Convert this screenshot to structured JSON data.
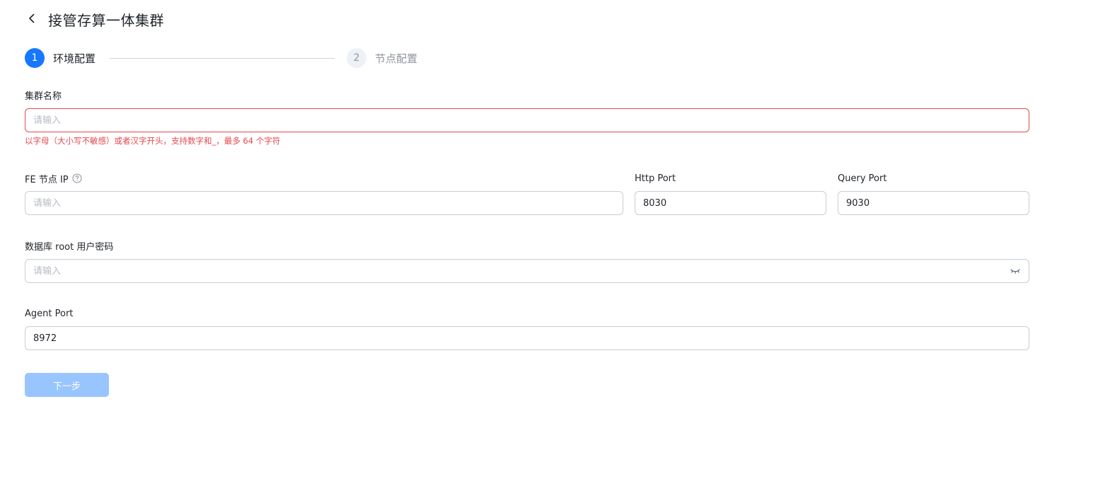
{
  "header": {
    "title": "接管存算一体集群"
  },
  "steps": [
    {
      "number": "1",
      "label": "环境配置",
      "status": "active"
    },
    {
      "number": "2",
      "label": "节点配置",
      "status": "wait"
    }
  ],
  "form": {
    "cluster_name": {
      "label": "集群名称",
      "placeholder": "请输入",
      "value": "",
      "error": "以字母（大小写不敏感）或者汉字开头，支持数字和_，最多 64 个字符"
    },
    "fe_node_ip": {
      "label": "FE 节点 IP",
      "placeholder": "请输入",
      "value": ""
    },
    "http_port": {
      "label": "Http Port",
      "value": "8030"
    },
    "query_port": {
      "label": "Query Port",
      "value": "9030"
    },
    "root_password": {
      "label": "数据库 root 用户密码",
      "placeholder": "请输入",
      "value": ""
    },
    "agent_port": {
      "label": "Agent Port",
      "value": "8972"
    },
    "next_button": "下一步"
  },
  "icons": {
    "back": "chevron-left-icon",
    "help": "question-circle-icon",
    "password_toggle": "eye-closed-icon"
  },
  "colors": {
    "primary": "#1677ff",
    "primary_disabled": "#99c5ff",
    "error": "#e5484d",
    "border": "#c9cdd4"
  }
}
